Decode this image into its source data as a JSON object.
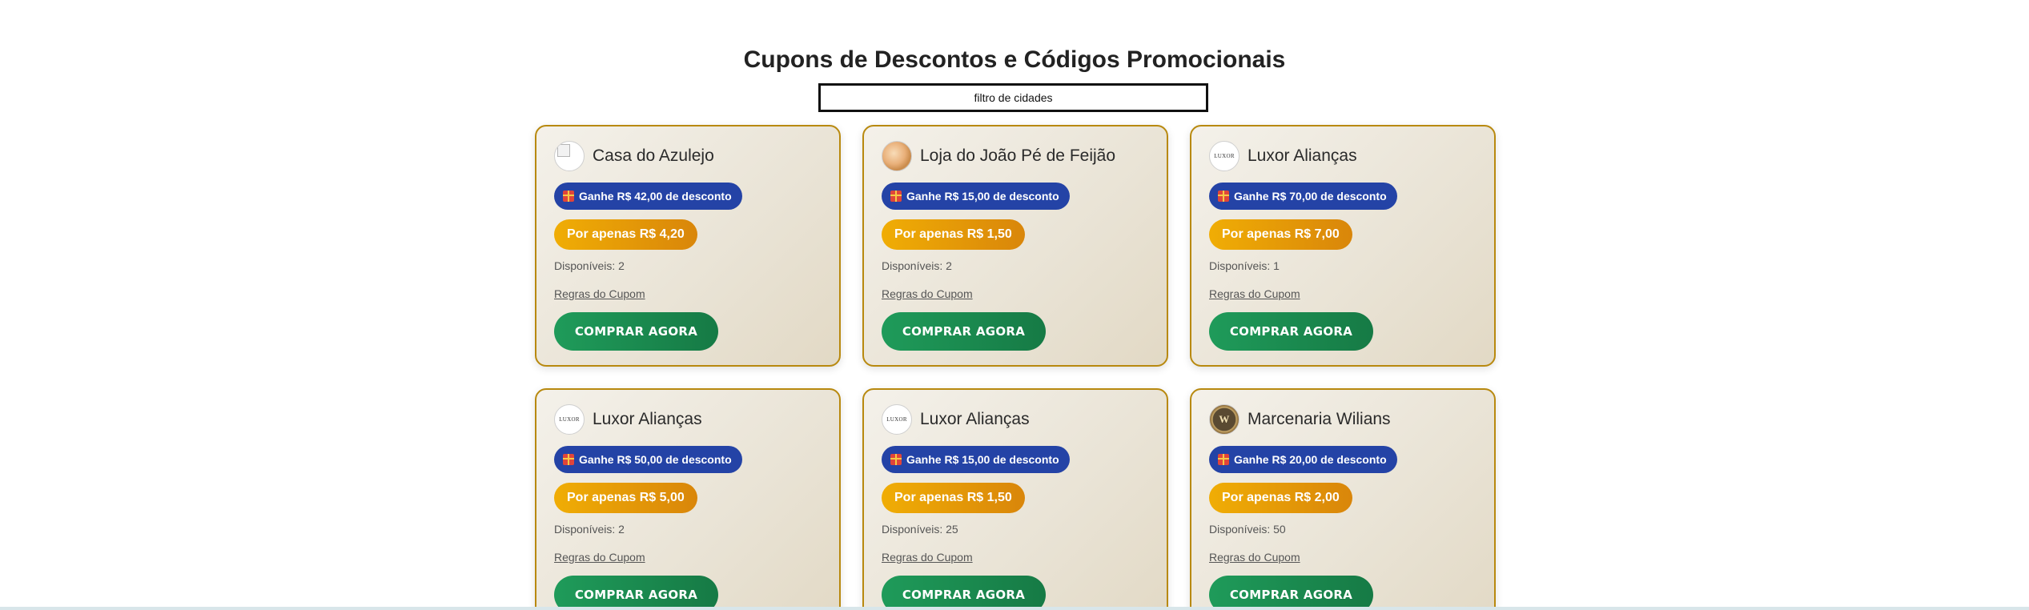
{
  "page": {
    "title": "Cupons de Descontos e Códigos Promocionais",
    "filter_placeholder": "filtro de cidades"
  },
  "icons": {
    "discount": "gift-icon"
  },
  "colors": {
    "card_border": "#b8890f",
    "discount_badge": "#2443a6",
    "price_badge": "#f0ad05",
    "buy_button": "#1f9b5a"
  },
  "coupons": [
    {
      "store": "Casa do Azulejo",
      "logo": "broken-image",
      "logo_text": "",
      "discount": "Ganhe R$ 42,00 de desconto",
      "price": "Por apenas R$ 4,20",
      "available": "Disponíveis: 2",
      "rules": "Regras do Cupom",
      "buy": "COMPRAR AGORA"
    },
    {
      "store": "Loja do João Pé de Feijão",
      "logo": "photo",
      "logo_text": "",
      "discount": "Ganhe R$ 15,00 de desconto",
      "price": "Por apenas R$ 1,50",
      "available": "Disponíveis: 2",
      "rules": "Regras do Cupom",
      "buy": "COMPRAR AGORA"
    },
    {
      "store": "Luxor Alianças",
      "logo": "text-logo",
      "logo_text": "LUXOR",
      "discount": "Ganhe R$ 70,00 de desconto",
      "price": "Por apenas R$ 7,00",
      "available": "Disponíveis: 1",
      "rules": "Regras do Cupom",
      "buy": "COMPRAR AGORA"
    },
    {
      "store": "Luxor Alianças",
      "logo": "text-logo",
      "logo_text": "LUXOR",
      "discount": "Ganhe R$ 50,00 de desconto",
      "price": "Por apenas R$ 5,00",
      "available": "Disponíveis: 2",
      "rules": "Regras do Cupom",
      "buy": "COMPRAR AGORA"
    },
    {
      "store": "Luxor Alianças",
      "logo": "text-logo",
      "logo_text": "LUXOR",
      "discount": "Ganhe R$ 15,00 de desconto",
      "price": "Por apenas R$ 1,50",
      "available": "Disponíveis: 25",
      "rules": "Regras do Cupom",
      "buy": "COMPRAR AGORA"
    },
    {
      "store": "Marcenaria Wilians",
      "logo": "medal",
      "logo_text": "W",
      "discount": "Ganhe R$ 20,00 de desconto",
      "price": "Por apenas R$ 2,00",
      "available": "Disponíveis: 50",
      "rules": "Regras do Cupom",
      "buy": "COMPRAR AGORA"
    }
  ]
}
